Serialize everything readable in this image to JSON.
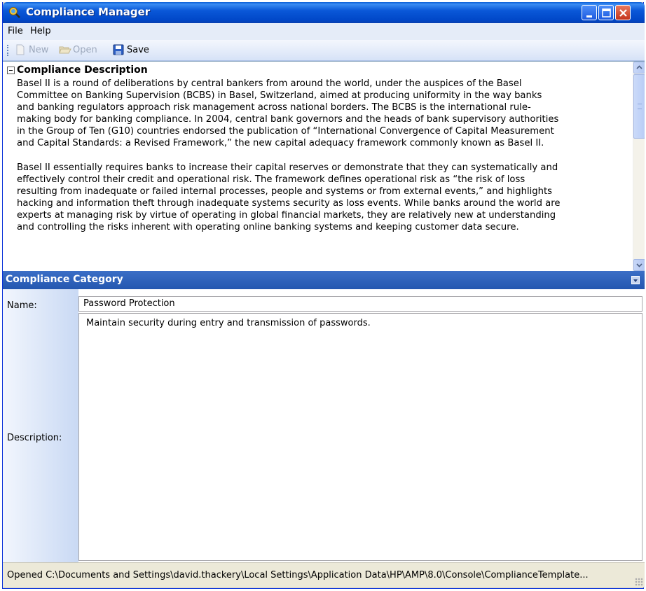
{
  "window": {
    "title": "Compliance Manager"
  },
  "menu": {
    "file": "File",
    "help": "Help"
  },
  "toolbar": {
    "new_label": "New",
    "open_label": "Open",
    "save_label": "Save"
  },
  "description_pane": {
    "heading": "Compliance Description",
    "text": "Basel II is a round of deliberations by central bankers from around the world, under the auspices of the Basel\nCommittee on Banking Supervision (BCBS) in Basel, Switzerland, aimed at producing uniformity in the way banks\nand banking regulators approach risk management across national borders. The BCBS is the international rule-\nmaking body for banking compliance. In 2004, central bank governors and the heads of bank supervisory authorities\nin the Group of Ten (G10) countries endorsed the publication of “International Convergence of Capital Measurement\nand Capital Standards: a Revised Framework,” the new capital adequacy framework commonly known as Basel II.\n\nBasel II essentially requires banks to increase their capital reserves or demonstrate that they can systematically and\neffectively control their credit and operational risk. The framework defines operational risk as “the risk of loss\nresulting from inadequate or failed internal processes, people and systems or from external events,” and highlights\nhacking and information theft through inadequate systems security as loss events. While banks around the world are\nexperts at managing risk by virtue of operating in global financial markets, they are relatively new at understanding\nand controlling the risks inherent with operating online banking systems and keeping customer data secure."
  },
  "category": {
    "header": "Compliance Category",
    "name_label": "Name:",
    "name_value": "Password Protection",
    "description_label": "Description:",
    "description_value": "Maintain security during entry and transmission of passwords."
  },
  "status": {
    "text": "Opened C:\\Documents and Settings\\david.thackery\\Local Settings\\Application Data\\HP\\AMP\\8.0\\Console\\ComplianceTemplate..."
  },
  "colors": {
    "title_bar": "#0a58d8",
    "category_header": "#2f63bd",
    "status_bar": "#ece9d8"
  }
}
